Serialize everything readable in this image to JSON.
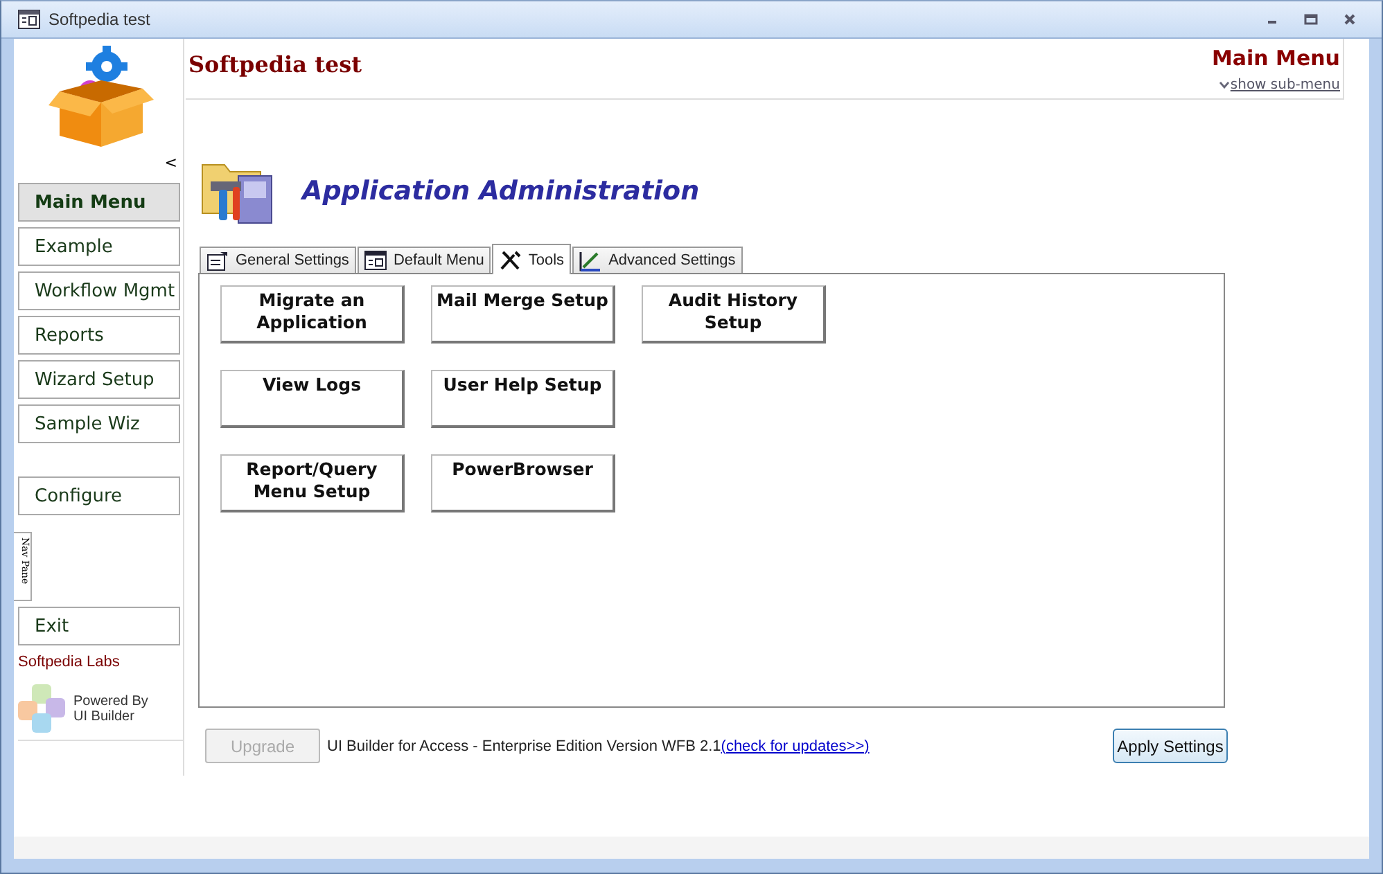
{
  "window": {
    "title": "Softpedia test"
  },
  "sidebar": {
    "collapse_glyph": "<",
    "items": [
      {
        "label": "Main Menu",
        "selected": true
      },
      {
        "label": "Example",
        "selected": false
      },
      {
        "label": "Workflow Mgmt",
        "selected": false
      },
      {
        "label": "Reports",
        "selected": false
      },
      {
        "label": "Wizard Setup",
        "selected": false
      },
      {
        "label": "Sample Wiz",
        "selected": false
      }
    ],
    "configure": "Configure",
    "nav_pane_tab": "Nav Pane",
    "exit": "Exit",
    "company": "Softpedia Labs",
    "powered_by": [
      "Powered By",
      "UI Builder"
    ]
  },
  "header": {
    "app_title": "Softpedia test",
    "menu_title": "Main Menu",
    "submenu_link": "show sub-menu"
  },
  "section_title": "Application Administration",
  "tabs": [
    {
      "label": "General Settings",
      "selected": false,
      "kind": "settings"
    },
    {
      "label": "Default Menu",
      "selected": false,
      "kind": "menu"
    },
    {
      "label": "Tools",
      "selected": true,
      "kind": "tools"
    },
    {
      "label": "Advanced Settings",
      "selected": false,
      "kind": "advanced"
    }
  ],
  "tool_buttons": [
    [
      "Migrate an Application",
      "Mail Merge Setup",
      "Audit History Setup"
    ],
    [
      "View Logs",
      "User Help Setup"
    ],
    [
      "Report/Query Menu Setup",
      "PowerBrowser"
    ]
  ],
  "footer": {
    "upgrade": {
      "label": "Upgrade",
      "disabled": true
    },
    "version": "UI Builder for Access - Enterprise Edition Version  WFB 2.1",
    "update_link": "(check for updates>>)",
    "apply": "Apply Settings"
  }
}
